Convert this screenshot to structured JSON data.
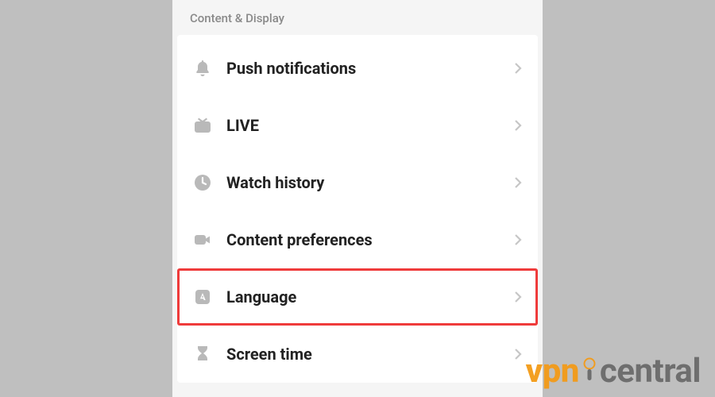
{
  "section_header": "Content & Display",
  "items": [
    {
      "id": "push-notifications",
      "label": "Push notifications",
      "icon": "bell-icon",
      "highlight": false
    },
    {
      "id": "live",
      "label": "LIVE",
      "icon": "tv-icon",
      "highlight": false
    },
    {
      "id": "watch-history",
      "label": "Watch history",
      "icon": "clock-icon",
      "highlight": false
    },
    {
      "id": "content-preferences",
      "label": "Content preferences",
      "icon": "video-icon",
      "highlight": false
    },
    {
      "id": "language",
      "label": "Language",
      "icon": "language-icon",
      "highlight": true
    },
    {
      "id": "screen-time",
      "label": "Screen time",
      "icon": "hourglass-icon",
      "highlight": false
    }
  ],
  "watermark": {
    "left": "vpn",
    "right": "central"
  }
}
